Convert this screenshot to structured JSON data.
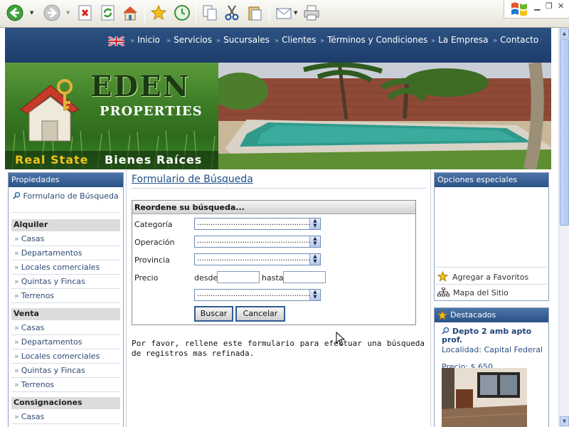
{
  "nav": {
    "items": [
      "Inicio",
      "Servicios",
      "Sucursales",
      "Clientes",
      "Términos y Condiciones",
      "La Empresa",
      "Contacto"
    ],
    "raquo": "»"
  },
  "banner": {
    "logo_main": "EDEN",
    "logo_sub": "PROPERTIES",
    "slogan_en": "Real State",
    "slogan_es": "Bienes Raíces"
  },
  "left": {
    "title": "Propiedades",
    "search_link": "Formulario de Búsqueda",
    "sections": [
      {
        "heading": "Alquiler",
        "items": [
          "Casas",
          "Departamentos",
          "Locales comerciales",
          "Quintas y Fincas",
          "Terrenos"
        ]
      },
      {
        "heading": "Venta",
        "items": [
          "Casas",
          "Departamentos",
          "Locales comerciales",
          "Quintas y Fincas",
          "Terrenos"
        ]
      },
      {
        "heading": "Consignaciones",
        "items": [
          "Casas"
        ]
      }
    ]
  },
  "main": {
    "title": "Formulario de Búsqueda",
    "form_title": "Reordene su búsqueda...",
    "labels": {
      "categoria": "Categoría",
      "operacion": "Operación",
      "provincia": "Provincia",
      "precio": "Precio",
      "desde": "desde",
      "hasta": "hasta"
    },
    "select_placeholder": "...................................................",
    "buttons": {
      "search": "Buscar",
      "cancel": "Cancelar"
    },
    "help": "Por favor, rellene este formulario para efectuar una búsqueda de registros mas refinada."
  },
  "right": {
    "options_title": "Opciones especiales",
    "favorites": "Agregar a Favoritos",
    "sitemap": "Mapa del Sitio",
    "featured_title": "Destacados",
    "featured": {
      "name": "Depto 2 amb apto prof.",
      "location_label": "Localidad:",
      "location": "Capital Federal",
      "price_label": "Precio:",
      "price": "$ 650"
    }
  },
  "colors": {
    "nav_bg": "#2c5282",
    "box_head": "#2a5286",
    "link": "#2e4a74",
    "slogan_accent": "#f0c419"
  }
}
